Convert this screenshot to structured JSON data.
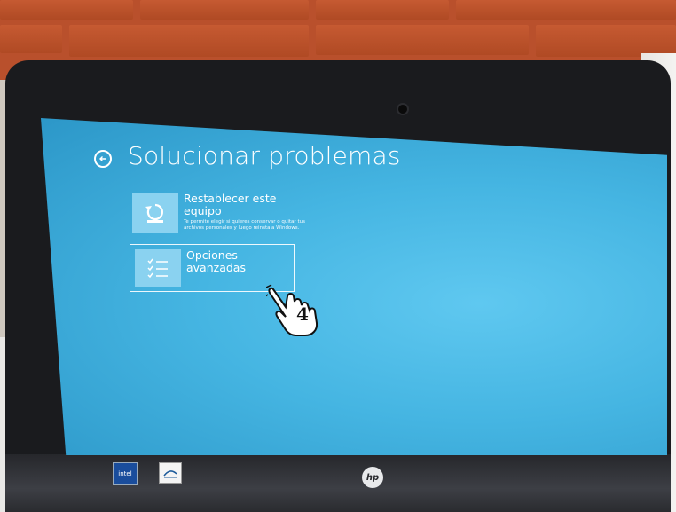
{
  "screen": {
    "title": "Solucionar problemas",
    "back_icon": "arrow-left-circle-icon",
    "options": [
      {
        "icon": "refresh-pc-icon",
        "title": "Restablecer este equipo",
        "description": "Te permite elegir si quieres conservar o quitar tus archivos personales y luego reinstala Windows."
      },
      {
        "icon": "checklist-icon",
        "title": "Opciones avanzadas",
        "description": ""
      }
    ]
  },
  "annotation": {
    "step_number": "4",
    "cursor_icon": "hand-pointer-icon"
  },
  "monitor": {
    "brand_logo": "hp",
    "badges": [
      "intel-logo",
      "energy-star-logo"
    ]
  },
  "colors": {
    "screen_blue": "#45b5e2",
    "tile_blue": "#8ad2f0",
    "bezel": "#1a1b1e",
    "brick": "#b9502c"
  }
}
